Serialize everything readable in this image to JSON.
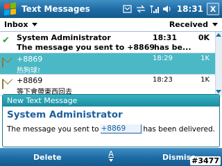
{
  "titlebar": {
    "title": "Text Messages",
    "time": "18:31",
    "close_label": "X",
    "icons": [
      "windows-start-icon",
      "inbox-tray-icon",
      "sync-arrows-icon",
      "signal-strength-icon",
      "volume-icon"
    ]
  },
  "filter": {
    "folder": "Inbox",
    "sort": "Received"
  },
  "messages": [
    {
      "icon": "check-read-icon",
      "sender": "System Administrator",
      "time": "18:31",
      "size": "0K",
      "preview": "The message you sent to +8869",
      "preview_tail": "has be...",
      "unread": true
    },
    {
      "icon": "envelope-icon",
      "sender": "+8869",
      "time": "18:29",
      "size": "1K",
      "preview": "热狗球!",
      "selected": true
    },
    {
      "icon": "envelope-icon",
      "sender": "+8869",
      "time": "18:23",
      "size": "1K",
      "preview": "等下會帶東西回去"
    }
  ],
  "notification": {
    "header": "New Text Message",
    "title": "System Administrator",
    "body_before": "The message you sent to",
    "number": "+8869",
    "body_after": "has been delivered."
  },
  "menubar": {
    "left": "Delete",
    "keyboard": "A",
    "right": "Dismiss"
  },
  "watermark": "#3477",
  "colors": {
    "titlebar": "#1d6aa3",
    "selection": "#4bb8c6",
    "notify_header": "#1b8da0",
    "notify_title": "#1b5f9c"
  }
}
